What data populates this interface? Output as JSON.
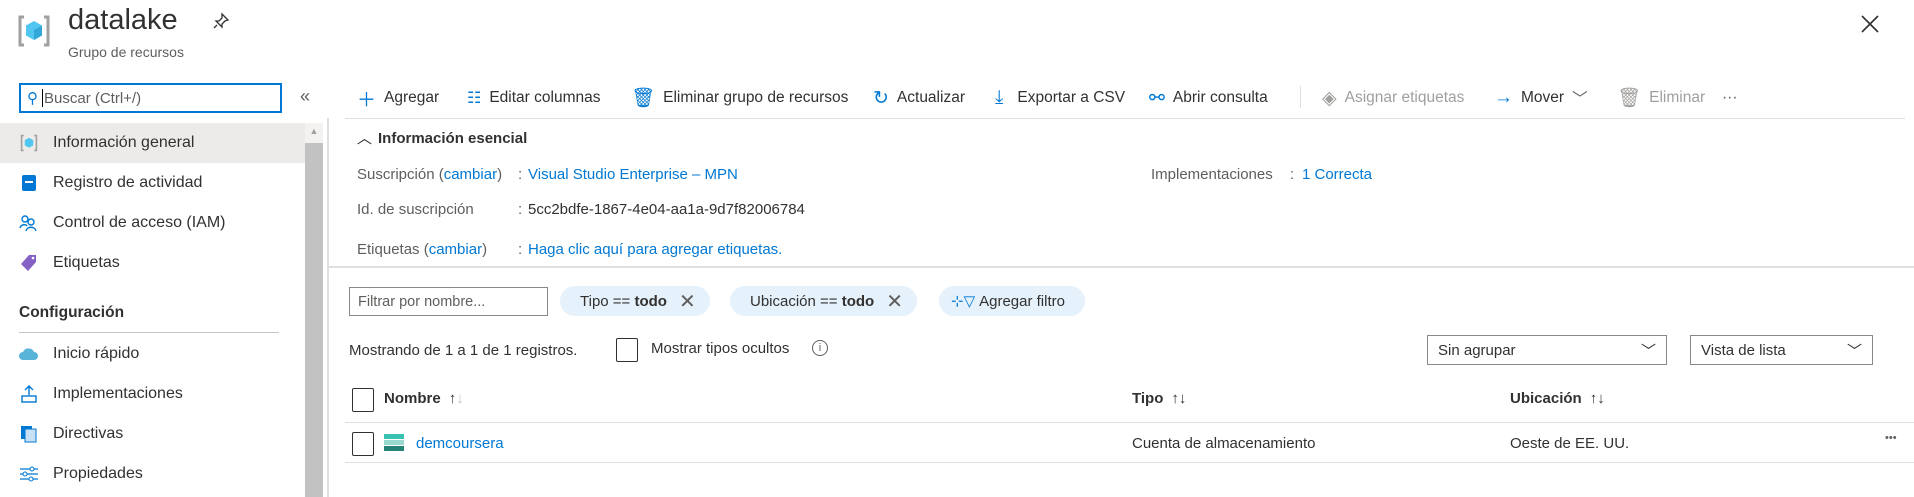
{
  "header": {
    "title": "datalake",
    "subtitle": "Grupo de recursos"
  },
  "sidebar": {
    "search_placeholder": "Buscar (Ctrl+/)",
    "collapse": "«",
    "items": [
      {
        "label": "Información general",
        "icon": "resource-group-icon"
      },
      {
        "label": "Registro de actividad",
        "icon": "activity-log-icon"
      },
      {
        "label": "Control de acceso (IAM)",
        "icon": "people-icon"
      },
      {
        "label": "Etiquetas",
        "icon": "tag-icon"
      }
    ],
    "section": "Configuración",
    "config_items": [
      {
        "label": "Inicio rápido",
        "icon": "cloud-icon"
      },
      {
        "label": "Implementaciones",
        "icon": "upload-icon"
      },
      {
        "label": "Directivas",
        "icon": "policy-icon"
      },
      {
        "label": "Propiedades",
        "icon": "properties-icon"
      }
    ]
  },
  "toolbar": {
    "add": "Agregar",
    "edit_columns": "Editar columnas",
    "delete_group": "Eliminar grupo de recursos",
    "refresh": "Actualizar",
    "export": "Exportar a CSV",
    "open_query": "Abrir consulta",
    "assign_tags": "Asignar etiquetas",
    "move": "Mover",
    "delete": "Eliminar",
    "more": "···"
  },
  "essentials": {
    "title": "Información esencial",
    "subscription_label": "Suscripción",
    "change": "cambiar",
    "subscription_value": "Visual Studio Enterprise – MPN",
    "subscription_id_label": "Id. de suscripción",
    "subscription_id": "5cc2bdfe-1867-4e04-aa1a-9d7f82006784",
    "tags_label": "Etiquetas",
    "tags_value": "Haga clic aquí para agregar etiquetas.",
    "deployments_label": "Implementaciones",
    "deployments_value": "1 Correcta"
  },
  "filters": {
    "name_placeholder": "Filtrar por nombre...",
    "type_pill": {
      "key": "Tipo ==",
      "value": "todo"
    },
    "location_pill": {
      "key": "Ubicación ==",
      "value": "todo"
    },
    "add_filter": "Agregar filtro"
  },
  "list": {
    "count_text": "Mostrando de 1 a 1 de 1 registros.",
    "show_hidden": "Mostrar tipos ocultos",
    "group_select": "Sin agrupar",
    "view_select": "Vista de lista",
    "columns": [
      "Nombre",
      "Tipo",
      "Ubicación"
    ],
    "rows": [
      {
        "name": "demcoursera",
        "type": "Cuenta de almacenamiento",
        "location": "Oeste de EE. UU."
      }
    ],
    "row_more": "•••"
  },
  "colors": {
    "accent": "#0078d4",
    "active_bg": "#edebe9",
    "pill_bg": "#e5f1fb"
  }
}
